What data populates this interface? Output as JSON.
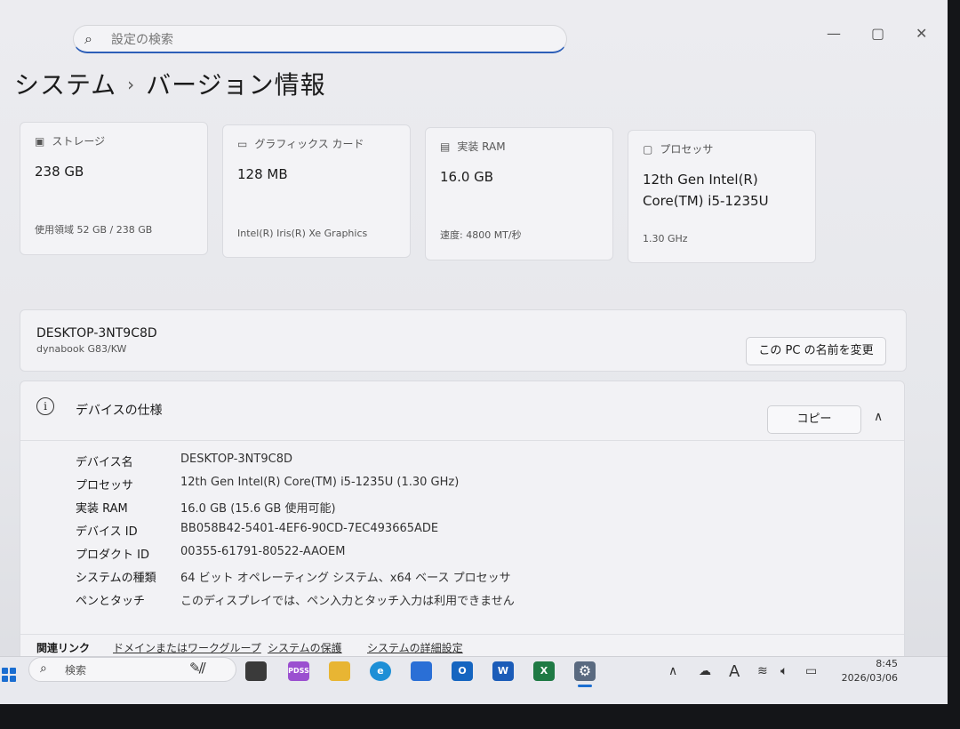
{
  "search": {
    "placeholder": "設定の検索"
  },
  "window_controls": {
    "minimize": "—",
    "maximize": "▢",
    "close": "✕"
  },
  "breadcrumb": {
    "parent": "システム",
    "separator": "›",
    "current": "バージョン情報"
  },
  "cards": [
    {
      "label": "ストレージ",
      "value": "238 GB",
      "sub": "使用領域 52 GB / 238 GB",
      "icon": "storage-icon"
    },
    {
      "label": "グラフィックス カード",
      "value": "128 MB",
      "sub": "Intel(R) Iris(R) Xe Graphics",
      "icon": "gpu-icon"
    },
    {
      "label": "実装 RAM",
      "value": "16.0 GB",
      "sub": "速度: 4800 MT/秒",
      "icon": "ram-icon"
    },
    {
      "label": "プロセッサ",
      "value": "12th Gen Intel(R) Core(TM) i5-1235U",
      "sub": "1.30 GHz",
      "icon": "cpu-icon"
    }
  ],
  "device": {
    "name": "DESKTOP-3NT9C8D",
    "model": "dynabook G83/KW",
    "rename_label": "この PC の名前を変更"
  },
  "specs": {
    "title": "デバイスの仕様",
    "copy_label": "コピー",
    "rows": [
      {
        "k": "デバイス名",
        "v": "DESKTOP-3NT9C8D"
      },
      {
        "k": "プロセッサ",
        "v": "12th Gen Intel(R) Core(TM) i5-1235U (1.30 GHz)"
      },
      {
        "k": "実装 RAM",
        "v": "16.0 GB (15.6 GB 使用可能)"
      },
      {
        "k": "デバイス ID",
        "v": "BB058B42-5401-4EF6-90CD-7EC493665ADE"
      },
      {
        "k": "プロダクト ID",
        "v": "00355-61791-80522-AAOEM"
      },
      {
        "k": "システムの種類",
        "v": "64 ビット オペレーティング システム、x64 ベース プロセッサ"
      },
      {
        "k": "ペンとタッチ",
        "v": "このディスプレイでは、ペン入力とタッチ入力は利用できません"
      }
    ]
  },
  "related": {
    "title": "関連リンク",
    "links": [
      "ドメインまたはワークグループ",
      "システムの保護",
      "システムの詳細設定"
    ]
  },
  "taskbar": {
    "search_label": "検索",
    "apps": [
      {
        "name": "task-view-app",
        "label": "",
        "color": "#3a3a3a"
      },
      {
        "name": "copilot-app",
        "label": "PDSS",
        "color": "#9b4fd0"
      },
      {
        "name": "file-explorer-app",
        "label": "",
        "color": "#e8b533"
      },
      {
        "name": "edge-app",
        "label": "e",
        "color": "#1d8fd6"
      },
      {
        "name": "store-app",
        "label": "",
        "color": "#2a6fd6"
      },
      {
        "name": "outlook-app",
        "label": "O",
        "color": "#1565c0"
      },
      {
        "name": "word-app",
        "label": "W",
        "color": "#1b5cb8"
      },
      {
        "name": "excel-app",
        "label": "X",
        "color": "#1f7a44"
      },
      {
        "name": "settings-app",
        "label": "⚙",
        "color": "#5a6a80"
      }
    ],
    "tray": {
      "chevron": "∧",
      "ime": "A"
    },
    "time": "8:45",
    "date": "2026/03/06"
  }
}
